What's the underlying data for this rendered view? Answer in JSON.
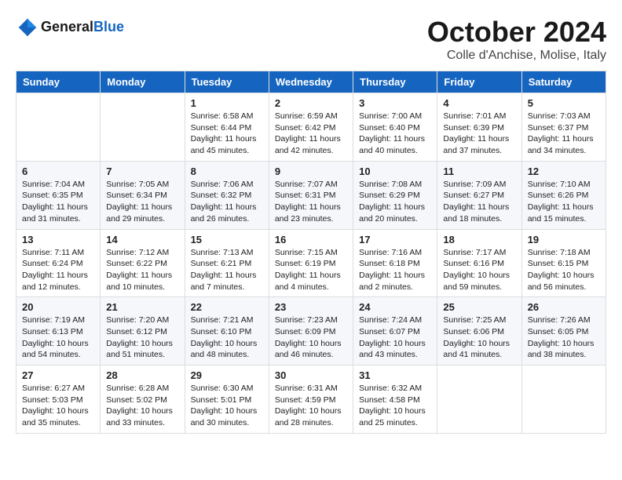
{
  "header": {
    "logo_line1": "General",
    "logo_line2": "Blue",
    "month": "October 2024",
    "location": "Colle d'Anchise, Molise, Italy"
  },
  "days_of_week": [
    "Sunday",
    "Monday",
    "Tuesday",
    "Wednesday",
    "Thursday",
    "Friday",
    "Saturday"
  ],
  "weeks": [
    [
      {
        "num": "",
        "sunrise": "",
        "sunset": "",
        "daylight": ""
      },
      {
        "num": "",
        "sunrise": "",
        "sunset": "",
        "daylight": ""
      },
      {
        "num": "1",
        "sunrise": "Sunrise: 6:58 AM",
        "sunset": "Sunset: 6:44 PM",
        "daylight": "Daylight: 11 hours and 45 minutes."
      },
      {
        "num": "2",
        "sunrise": "Sunrise: 6:59 AM",
        "sunset": "Sunset: 6:42 PM",
        "daylight": "Daylight: 11 hours and 42 minutes."
      },
      {
        "num": "3",
        "sunrise": "Sunrise: 7:00 AM",
        "sunset": "Sunset: 6:40 PM",
        "daylight": "Daylight: 11 hours and 40 minutes."
      },
      {
        "num": "4",
        "sunrise": "Sunrise: 7:01 AM",
        "sunset": "Sunset: 6:39 PM",
        "daylight": "Daylight: 11 hours and 37 minutes."
      },
      {
        "num": "5",
        "sunrise": "Sunrise: 7:03 AM",
        "sunset": "Sunset: 6:37 PM",
        "daylight": "Daylight: 11 hours and 34 minutes."
      }
    ],
    [
      {
        "num": "6",
        "sunrise": "Sunrise: 7:04 AM",
        "sunset": "Sunset: 6:35 PM",
        "daylight": "Daylight: 11 hours and 31 minutes."
      },
      {
        "num": "7",
        "sunrise": "Sunrise: 7:05 AM",
        "sunset": "Sunset: 6:34 PM",
        "daylight": "Daylight: 11 hours and 29 minutes."
      },
      {
        "num": "8",
        "sunrise": "Sunrise: 7:06 AM",
        "sunset": "Sunset: 6:32 PM",
        "daylight": "Daylight: 11 hours and 26 minutes."
      },
      {
        "num": "9",
        "sunrise": "Sunrise: 7:07 AM",
        "sunset": "Sunset: 6:31 PM",
        "daylight": "Daylight: 11 hours and 23 minutes."
      },
      {
        "num": "10",
        "sunrise": "Sunrise: 7:08 AM",
        "sunset": "Sunset: 6:29 PM",
        "daylight": "Daylight: 11 hours and 20 minutes."
      },
      {
        "num": "11",
        "sunrise": "Sunrise: 7:09 AM",
        "sunset": "Sunset: 6:27 PM",
        "daylight": "Daylight: 11 hours and 18 minutes."
      },
      {
        "num": "12",
        "sunrise": "Sunrise: 7:10 AM",
        "sunset": "Sunset: 6:26 PM",
        "daylight": "Daylight: 11 hours and 15 minutes."
      }
    ],
    [
      {
        "num": "13",
        "sunrise": "Sunrise: 7:11 AM",
        "sunset": "Sunset: 6:24 PM",
        "daylight": "Daylight: 11 hours and 12 minutes."
      },
      {
        "num": "14",
        "sunrise": "Sunrise: 7:12 AM",
        "sunset": "Sunset: 6:22 PM",
        "daylight": "Daylight: 11 hours and 10 minutes."
      },
      {
        "num": "15",
        "sunrise": "Sunrise: 7:13 AM",
        "sunset": "Sunset: 6:21 PM",
        "daylight": "Daylight: 11 hours and 7 minutes."
      },
      {
        "num": "16",
        "sunrise": "Sunrise: 7:15 AM",
        "sunset": "Sunset: 6:19 PM",
        "daylight": "Daylight: 11 hours and 4 minutes."
      },
      {
        "num": "17",
        "sunrise": "Sunrise: 7:16 AM",
        "sunset": "Sunset: 6:18 PM",
        "daylight": "Daylight: 11 hours and 2 minutes."
      },
      {
        "num": "18",
        "sunrise": "Sunrise: 7:17 AM",
        "sunset": "Sunset: 6:16 PM",
        "daylight": "Daylight: 10 hours and 59 minutes."
      },
      {
        "num": "19",
        "sunrise": "Sunrise: 7:18 AM",
        "sunset": "Sunset: 6:15 PM",
        "daylight": "Daylight: 10 hours and 56 minutes."
      }
    ],
    [
      {
        "num": "20",
        "sunrise": "Sunrise: 7:19 AM",
        "sunset": "Sunset: 6:13 PM",
        "daylight": "Daylight: 10 hours and 54 minutes."
      },
      {
        "num": "21",
        "sunrise": "Sunrise: 7:20 AM",
        "sunset": "Sunset: 6:12 PM",
        "daylight": "Daylight: 10 hours and 51 minutes."
      },
      {
        "num": "22",
        "sunrise": "Sunrise: 7:21 AM",
        "sunset": "Sunset: 6:10 PM",
        "daylight": "Daylight: 10 hours and 48 minutes."
      },
      {
        "num": "23",
        "sunrise": "Sunrise: 7:23 AM",
        "sunset": "Sunset: 6:09 PM",
        "daylight": "Daylight: 10 hours and 46 minutes."
      },
      {
        "num": "24",
        "sunrise": "Sunrise: 7:24 AM",
        "sunset": "Sunset: 6:07 PM",
        "daylight": "Daylight: 10 hours and 43 minutes."
      },
      {
        "num": "25",
        "sunrise": "Sunrise: 7:25 AM",
        "sunset": "Sunset: 6:06 PM",
        "daylight": "Daylight: 10 hours and 41 minutes."
      },
      {
        "num": "26",
        "sunrise": "Sunrise: 7:26 AM",
        "sunset": "Sunset: 6:05 PM",
        "daylight": "Daylight: 10 hours and 38 minutes."
      }
    ],
    [
      {
        "num": "27",
        "sunrise": "Sunrise: 6:27 AM",
        "sunset": "Sunset: 5:03 PM",
        "daylight": "Daylight: 10 hours and 35 minutes."
      },
      {
        "num": "28",
        "sunrise": "Sunrise: 6:28 AM",
        "sunset": "Sunset: 5:02 PM",
        "daylight": "Daylight: 10 hours and 33 minutes."
      },
      {
        "num": "29",
        "sunrise": "Sunrise: 6:30 AM",
        "sunset": "Sunset: 5:01 PM",
        "daylight": "Daylight: 10 hours and 30 minutes."
      },
      {
        "num": "30",
        "sunrise": "Sunrise: 6:31 AM",
        "sunset": "Sunset: 4:59 PM",
        "daylight": "Daylight: 10 hours and 28 minutes."
      },
      {
        "num": "31",
        "sunrise": "Sunrise: 6:32 AM",
        "sunset": "Sunset: 4:58 PM",
        "daylight": "Daylight: 10 hours and 25 minutes."
      },
      {
        "num": "",
        "sunrise": "",
        "sunset": "",
        "daylight": ""
      },
      {
        "num": "",
        "sunrise": "",
        "sunset": "",
        "daylight": ""
      }
    ]
  ]
}
